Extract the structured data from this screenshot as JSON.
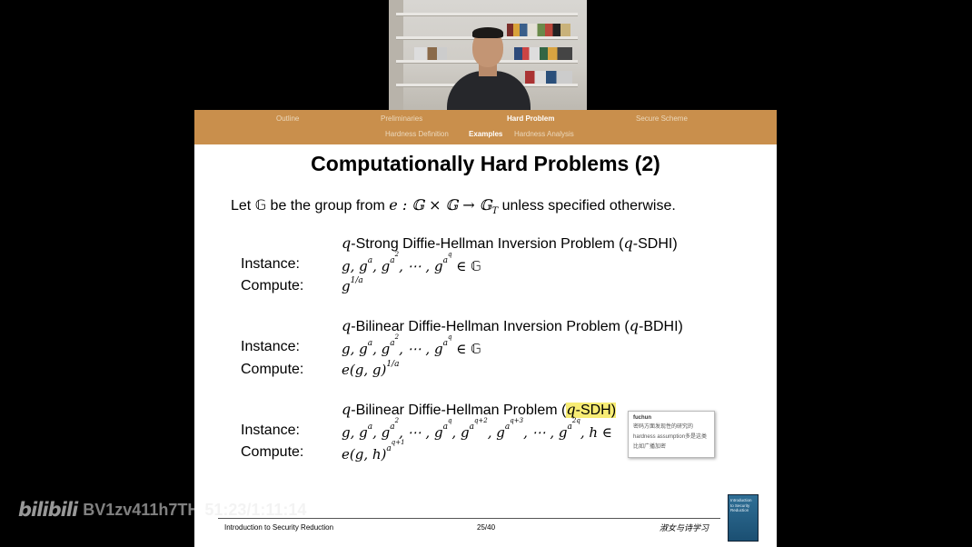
{
  "navbar": {
    "sections": [
      {
        "label": "Outline",
        "active": false
      },
      {
        "label": "Preliminaries",
        "active": false
      },
      {
        "label": "Hard Problem",
        "active": true
      },
      {
        "label": "Secure Scheme",
        "active": false
      }
    ],
    "subsections": [
      {
        "label": "Hardness Definition",
        "active": false
      },
      {
        "label": "Examples",
        "active": true
      },
      {
        "label": "Hardness Analysis",
        "active": false
      }
    ]
  },
  "slide": {
    "title": "Computationally Hard Problems (2)",
    "intro": {
      "pre": "Let ",
      "G": "𝔾",
      "mid": " be the group from ",
      "map": "e : 𝔾 × 𝔾 → 𝔾",
      "map_sub": "T",
      "post": " unless specified otherwise."
    },
    "instance_label": "Instance:",
    "compute_label": "Compute:",
    "problems": [
      {
        "q": "q",
        "title": "-Strong Diffie-Hellman Inversion Problem (",
        "abbr_q": "q",
        "abbr": "-SDHI)",
        "instance": "g, g^a, g^{a^2}, ⋯ , g^{a^q} ∈ 𝔾",
        "compute": "g^{1/a}"
      },
      {
        "q": "q",
        "title": "-Bilinear Diffie-Hellman Inversion Problem (",
        "abbr_q": "q",
        "abbr": "-BDHI)",
        "instance": "g, g^a, g^{a^2}, ⋯ , g^{a^q} ∈ 𝔾",
        "compute": "e(g, g)^{1/a}"
      },
      {
        "q": "q",
        "title": "-Bilinear Diffie-Hellman Problem (",
        "abbr_q": "q",
        "abbr": "-SDH)",
        "instance": "g, g^a, g^{a^2}, ⋯ , g^{a^q}, g^{a^{q+2}}, g^{a^{q+3}}, ⋯ , g^{a^{2q}}, h ∈",
        "compute": "e(g, h)^{a^{q+1}}"
      }
    ],
    "tooltip": {
      "author": "fuchun",
      "body": "密码方面发现性的研究的 hardness assumption多是这类 比如广播加密"
    },
    "footer": {
      "left": "Introduction to Security Reduction",
      "page": "25/40",
      "calligraphy": "淑女与诗学习",
      "book_title": "Introduction to Security Reduction"
    }
  },
  "watermark": {
    "logo": "bilibili",
    "code": "BV1zv411h7TH",
    "time": "51:23/1:11:14"
  }
}
